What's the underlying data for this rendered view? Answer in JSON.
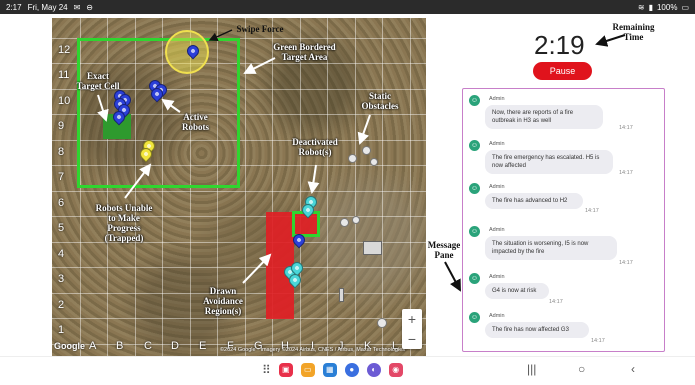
{
  "status_bar": {
    "time": "2:17",
    "date": "Fri, May 24",
    "battery": "100%"
  },
  "map": {
    "row_labels": [
      "12",
      "11",
      "10",
      "9",
      "8",
      "7",
      "6",
      "5",
      "4",
      "3",
      "2",
      "1"
    ],
    "col_labels": [
      "A",
      "B",
      "C",
      "D",
      "E",
      "F",
      "G",
      "H",
      "I",
      "J",
      "K",
      "L"
    ],
    "google_label": "Google",
    "attribution": "©2024 Google · Imagery ©2024 Airbus, CNES / Airbus, Maxar Technologies",
    "zoom_in": "+",
    "zoom_out": "−"
  },
  "annotations": {
    "swipe_force": "Swipe Force",
    "green_bordered": "Green Bordered\nTarget Area",
    "exact_target": "Exact\nTarget Cell",
    "active_robots": "Active\nRobots",
    "static_obstacles": "Static\nObstacles",
    "deactivated": "Deactivated\nRobot(s)",
    "trapped": "Robots Unable\nto Make\nProgress\n(Trapped)",
    "avoidance": "Drawn\nAvoidance\nRegion(s)",
    "remaining_time": "Remaining\nTime",
    "message_pane": "Message\nPane"
  },
  "timer": {
    "value": "2:19",
    "pause_label": "Pause"
  },
  "messages": [
    {
      "sender": "Admin",
      "text": "Now, there are reports of a fire outbreak in H3 as well",
      "time": "14:17"
    },
    {
      "sender": "Admin",
      "text": "The fire emergency has escalated. H5 is now affected",
      "time": "14:17"
    },
    {
      "sender": "Admin",
      "text": "The fire has advanced to H2",
      "time": "14:17"
    },
    {
      "sender": "Admin",
      "text": "The situation is worsening, I5 is now impacted by the fire",
      "time": "14:17"
    },
    {
      "sender": "Admin",
      "text": "G4 is now at risk",
      "time": "14:17"
    },
    {
      "sender": "Admin",
      "text": "The fire has now affected G3",
      "time": "14:17"
    }
  ],
  "icons": {
    "avatar_glyph": "☺",
    "nav_recent": "|||",
    "nav_home": "○",
    "nav_back": "‹",
    "dock_grid": "⠿"
  },
  "colors": {
    "target_border": "#2fd52f",
    "avoid_region": "#e01f25",
    "active_robot": "#2b3fd9",
    "deactivated_robot": "#49d6d8",
    "trapped_robot": "#f1e53b",
    "pause_button": "#e0131c",
    "pane_border": "#c77fc9"
  }
}
